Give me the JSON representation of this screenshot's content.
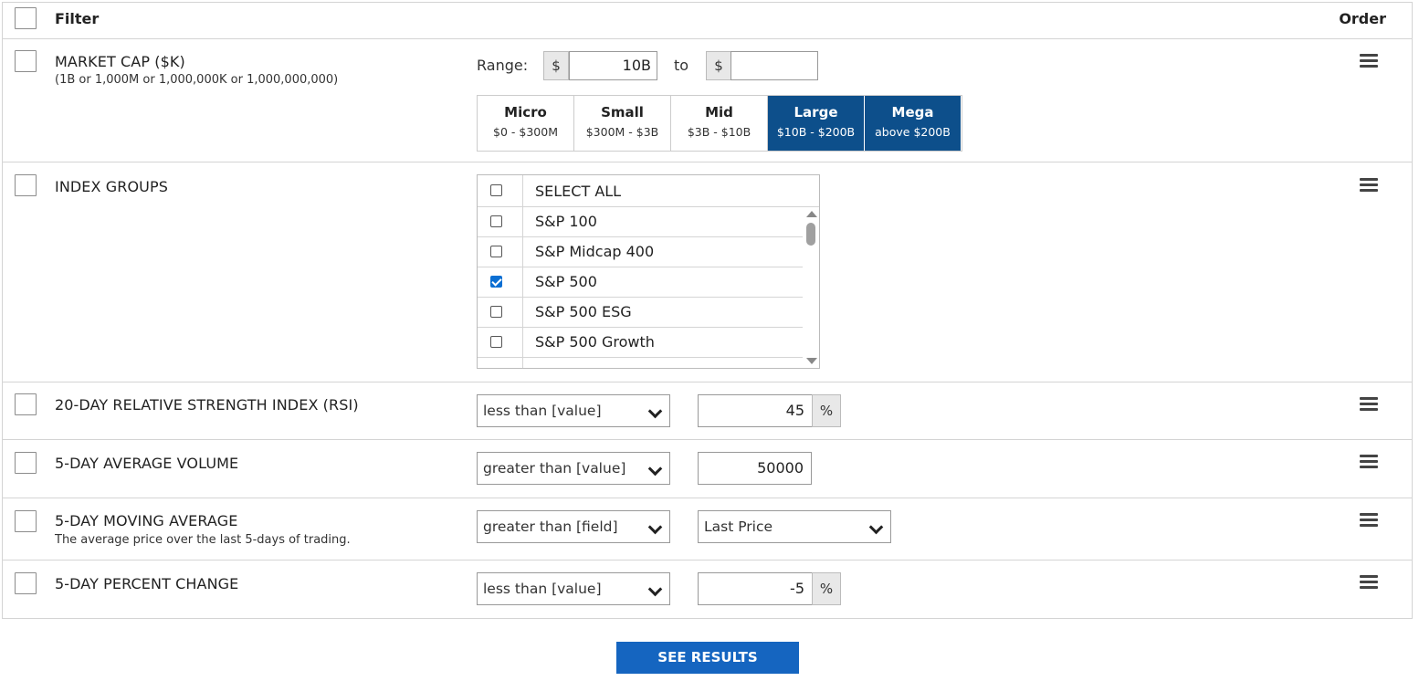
{
  "header": {
    "filter_label": "Filter",
    "order_label": "Order"
  },
  "market_cap": {
    "name": "MARKET CAP ($K)",
    "hint": "(1B or 1,000M or 1,000,000K or 1,000,000,000)",
    "range_label": "Range:",
    "currency": "$",
    "from_value": "10B",
    "to_label": "to",
    "to_value": "",
    "buckets": [
      {
        "title": "Micro",
        "range": "$0 - $300M",
        "selected": false
      },
      {
        "title": "Small",
        "range": "$300M - $3B",
        "selected": false
      },
      {
        "title": "Mid",
        "range": "$3B - $10B",
        "selected": false
      },
      {
        "title": "Large",
        "range": "$10B - $200B",
        "selected": true
      },
      {
        "title": "Mega",
        "range": "above $200B",
        "selected": true
      }
    ]
  },
  "index_groups": {
    "name": "INDEX GROUPS",
    "select_all": "SELECT ALL",
    "items": [
      {
        "label": "S&P 100",
        "checked": false
      },
      {
        "label": "S&P Midcap 400",
        "checked": false
      },
      {
        "label": "S&P 500",
        "checked": true
      },
      {
        "label": "S&P 500 ESG",
        "checked": false
      },
      {
        "label": "S&P 500 Growth",
        "checked": false
      }
    ]
  },
  "rsi": {
    "name": "20-DAY RELATIVE STRENGTH INDEX (RSI)",
    "operator": "less than [value]",
    "value": "45",
    "unit": "%"
  },
  "avg_volume": {
    "name": "5-DAY AVERAGE VOLUME",
    "operator": "greater than [value]",
    "value": "50000"
  },
  "moving_avg": {
    "name": "5-DAY MOVING AVERAGE",
    "description": "The average price over the last 5-days of trading.",
    "operator": "greater than [field]",
    "field": "Last Price"
  },
  "pct_change": {
    "name": "5-DAY PERCENT CHANGE",
    "operator": "less than [value]",
    "value": "-5",
    "unit": "%"
  },
  "actions": {
    "see_results": "SEE RESULTS"
  },
  "colors": {
    "selected_bucket": "#0d4f8b",
    "button": "#1565c0",
    "checkbox_checked": "#0b6fd3"
  }
}
